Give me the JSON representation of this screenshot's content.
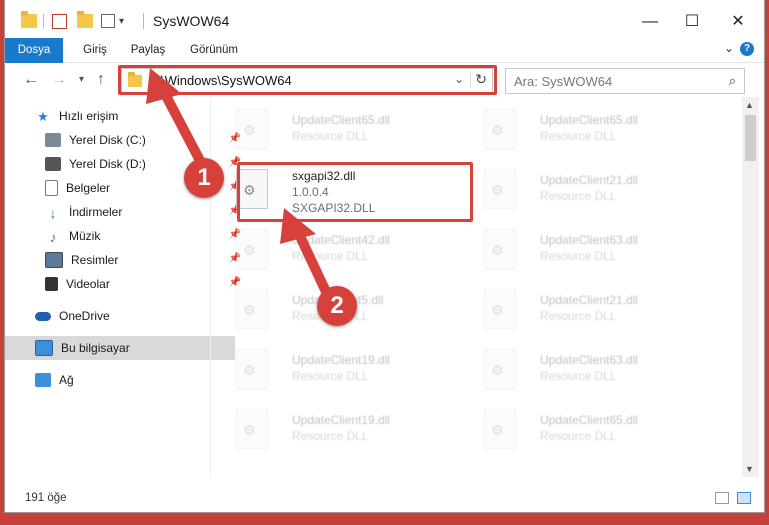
{
  "window": {
    "title": "SysWOW64",
    "controls": {
      "minimize": "—",
      "maximize": "☐",
      "close": "✕"
    }
  },
  "ribbon": {
    "tabs": [
      "Dosya",
      "Giriş",
      "Paylaş",
      "Görünüm"
    ],
    "help": "?",
    "collapse": "⌄"
  },
  "address": {
    "path": "C:\\Windows\\SysWOW64",
    "dropdown": "⌄",
    "refresh": "↻"
  },
  "search": {
    "placeholder": "Ara: SysWOW64"
  },
  "sidebar": {
    "items": [
      {
        "label": "Hızlı erişim",
        "pinned": false
      },
      {
        "label": "Yerel Disk (C:)",
        "pinned": true
      },
      {
        "label": "Yerel Disk (D:)",
        "pinned": true
      },
      {
        "label": "Belgeler",
        "pinned": true
      },
      {
        "label": "İndirmeler",
        "pinned": true
      },
      {
        "label": "Müzik",
        "pinned": true
      },
      {
        "label": "Resimler",
        "pinned": true
      },
      {
        "label": "Videolar",
        "pinned": true
      },
      {
        "label": "OneDrive",
        "pinned": false
      },
      {
        "label": "Bu bilgisayar",
        "pinned": false
      },
      {
        "label": "Ağ",
        "pinned": false
      }
    ]
  },
  "files": {
    "left": [
      {
        "name": "UpdateClient65.dll",
        "type": "Resource DLL"
      },
      {
        "name": "sxgapi32.dll",
        "type": "1.0.0.4",
        "sub": "SXGAPI32.DLL"
      },
      {
        "name": "UpdateClient42.dll",
        "type": "Resource DLL"
      },
      {
        "name": "UpdateClient5.dll",
        "type": "Resource DLL"
      },
      {
        "name": "UpdateClient19.dll",
        "type": "Resource DLL"
      },
      {
        "name": "UpdateClient19.dll",
        "type": "Resource DLL"
      }
    ],
    "right": [
      {
        "name": "UpdateClient65.dll",
        "type": "Resource DLL"
      },
      {
        "name": "UpdateClient21.dll",
        "type": "Resource DLL"
      },
      {
        "name": "UpdateClient63.dll",
        "type": "Resource DLL"
      },
      {
        "name": "UpdateClient21.dll",
        "type": "Resource DLL"
      },
      {
        "name": "UpdateClient63.dll",
        "type": "Resource DLL"
      },
      {
        "name": "UpdateClient65.dll",
        "type": "Resource DLL"
      }
    ]
  },
  "status": {
    "count": "191 öğe"
  },
  "annotations": {
    "step1": "1",
    "step2": "2"
  },
  "colors": {
    "accent": "#1979ca",
    "highlight": "#d7413c"
  }
}
